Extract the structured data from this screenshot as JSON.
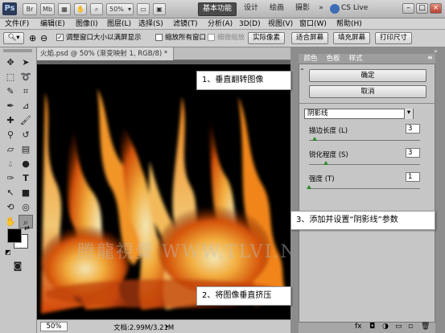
{
  "titlebar": {
    "app_logo": "Ps",
    "buttons": [
      "Br",
      "Mb"
    ],
    "zoom": "50%",
    "workspaces": [
      "基本功能",
      "设计",
      "绘画",
      "摄影"
    ],
    "more": "»",
    "cs_live": "CS Live",
    "window_controls": [
      "–",
      "□",
      "×"
    ]
  },
  "menubar": {
    "items": [
      "文件(F)",
      "编辑(E)",
      "图像(I)",
      "图层(L)",
      "选择(S)",
      "滤镜(T)",
      "分析(A)",
      "3D(D)",
      "视图(V)",
      "窗口(W)",
      "帮助(H)"
    ]
  },
  "optionsbar": {
    "checkbox_resize": "调整窗口大小以满屏显示",
    "checkbox_zoom_all": "缩放所有窗口",
    "checkbox_scrubby": "细微缩放",
    "btn_actual": "实际像素",
    "btn_fit": "适合屏幕",
    "btn_fill": "填充屏幕",
    "btn_print": "打印尺寸"
  },
  "document": {
    "tab_title": "火焰.psd @ 50% (渐变映射 1, RGB/8) *",
    "tab_close": "×",
    "status_zoom": "50%",
    "status_doc": "文档:2.99M/3.21M",
    "watermark": "腾龍視覺 WWW.TLVI.NET"
  },
  "panel": {
    "tabs": [
      "颜色",
      "色板",
      "样式"
    ],
    "ok": "确定",
    "cancel": "取消",
    "filter_select": "阴影线",
    "params": [
      {
        "label": "描边长度 (L)",
        "value": "3",
        "level": 0.05
      },
      {
        "label": "锐化程度 (S)",
        "value": "3",
        "level": 0.15
      },
      {
        "label": "强度 (T)",
        "value": "1",
        "level": 0.0
      }
    ]
  },
  "callouts": {
    "step1": "1、垂直翻转图像",
    "step2": "2、将图像垂直挤压",
    "step3": "3、添加并设置“阴影线”参数"
  },
  "colors": {
    "foreground": "#000000",
    "background": "#ffffff",
    "accent_slider": "#2c8a2c"
  }
}
